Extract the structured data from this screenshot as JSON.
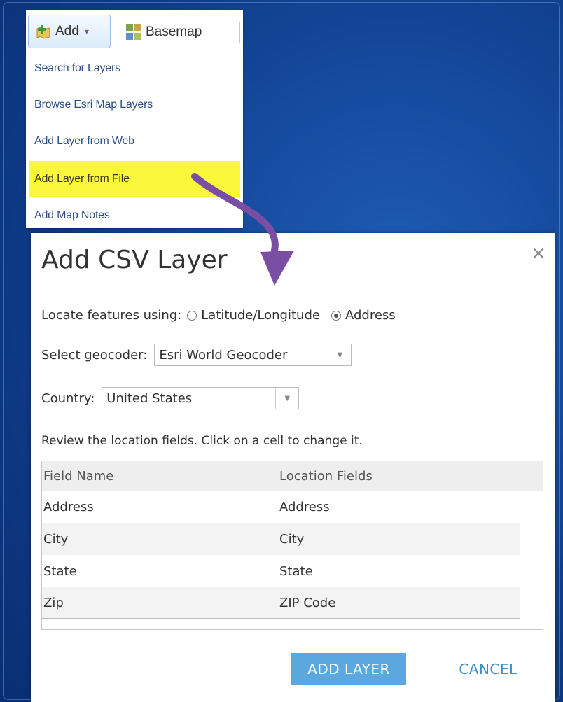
{
  "toolbar": {
    "add_label": "Add",
    "add_caret": "▾",
    "basemap_label": "Basemap"
  },
  "menu": {
    "items": [
      {
        "label": "Search for Layers"
      },
      {
        "label": "Browse Esri Map Layers"
      },
      {
        "label": "Add Layer from Web"
      },
      {
        "label": "Add Layer from File",
        "highlighted": true
      },
      {
        "label": "Add Map Notes"
      }
    ],
    "highlight_color": "#fbf73a"
  },
  "arrow_color": "#7a4fa3",
  "dialog": {
    "title": "Add CSV Layer",
    "close_glyph": "×",
    "locate": {
      "label": "Locate features using:",
      "options": [
        {
          "label": "Latitude/Longitude",
          "selected": false
        },
        {
          "label": "Address",
          "selected": true
        }
      ]
    },
    "geocoder": {
      "label": "Select geocoder:",
      "value": "Esri World Geocoder",
      "arrow": "▼"
    },
    "country": {
      "label": "Country:",
      "value": "United States",
      "arrow": "▼"
    },
    "review_text": "Review the location fields. Click on a cell to change it.",
    "table": {
      "headers": [
        "Field Name",
        "Location Fields"
      ],
      "rows": [
        [
          "Address",
          "Address"
        ],
        [
          "City",
          "City"
        ],
        [
          "State",
          "State"
        ],
        [
          "Zip",
          "ZIP Code"
        ]
      ]
    },
    "add_layer_label": "ADD LAYER",
    "cancel_label": "CANCEL",
    "accent_color": "#5aa8dd"
  }
}
